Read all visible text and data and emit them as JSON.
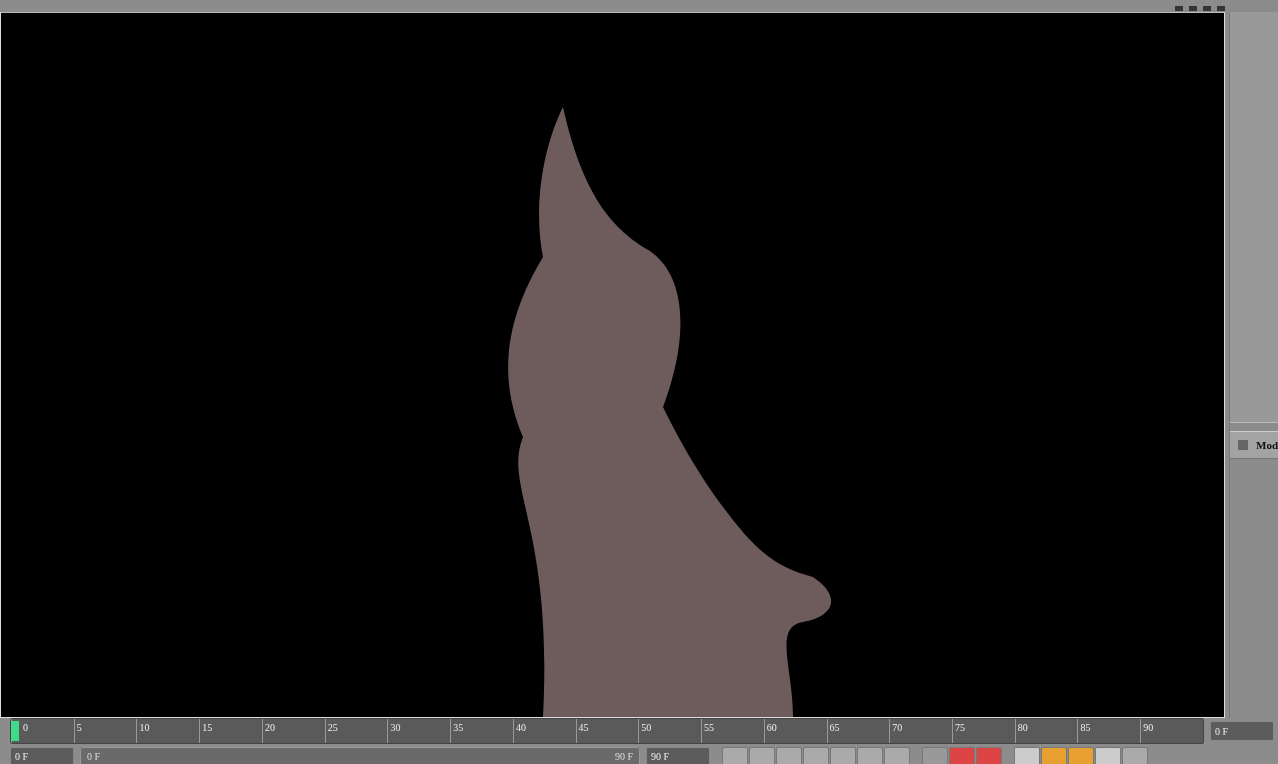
{
  "panel_tab": {
    "label": "Mod"
  },
  "timeline": {
    "ticks": [
      "0",
      "5",
      "10",
      "15",
      "20",
      "25",
      "30",
      "35",
      "40",
      "45",
      "50",
      "55",
      "60",
      "65",
      "70",
      "75",
      "80",
      "85",
      "90"
    ],
    "level": 0,
    "current_frame": "0 F"
  },
  "range": {
    "start_field": "0 F",
    "slider_start": "0 F",
    "slider_end": "90 F",
    "end_field": "90 F",
    "level": 1
  }
}
